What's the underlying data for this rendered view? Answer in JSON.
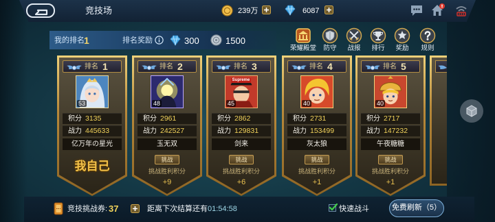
{
  "header": {
    "title": "竞技场",
    "gold": "239万",
    "diamonds": "6087"
  },
  "rank_bar": {
    "my_rank_label": "我的排名",
    "my_rank": "1",
    "reward_label": "排名奖励",
    "reward_diamonds": "300",
    "reward_silver": "1500"
  },
  "menu": [
    {
      "label": "荣耀殿堂",
      "icon": "hall-of-honor-icon"
    },
    {
      "label": "防守",
      "icon": "shield-icon"
    },
    {
      "label": "战报",
      "icon": "crossed-swords-icon"
    },
    {
      "label": "排行",
      "icon": "trophy-icon"
    },
    {
      "label": "奖励",
      "icon": "medal-icon"
    },
    {
      "label": "规则",
      "icon": "question-icon"
    }
  ],
  "labels": {
    "rank": "排名",
    "score": "积分",
    "power": "战力",
    "challenge": "挑战",
    "win_points": "挑战胜利积分"
  },
  "cards": [
    {
      "rank": "1",
      "level": "53",
      "score": "3135",
      "power": "445633",
      "name": "亿万年の星光",
      "self_label": "我自己",
      "is_self": true
    },
    {
      "rank": "2",
      "level": "48",
      "score": "2961",
      "power": "242527",
      "name": "玉无双",
      "win_bonus": "+9"
    },
    {
      "rank": "3",
      "level": "45",
      "score": "2862",
      "power": "129831",
      "name": "剑来",
      "win_bonus": "+6",
      "avatar_text": "Supreme"
    },
    {
      "rank": "4",
      "level": "40",
      "score": "2731",
      "power": "153499",
      "name": "灰太狼",
      "win_bonus": "+1"
    },
    {
      "rank": "5",
      "level": "40",
      "score": "2717",
      "power": "147232",
      "name": "午夜糖糖",
      "win_bonus": "+1"
    }
  ],
  "footer": {
    "ticket_label": "竞技挑战券:",
    "tickets": "37",
    "countdown_label": "距离下次结算还有",
    "countdown": "01:54:58",
    "quick_battle_label": "快速战斗",
    "quick_battle_checked": true,
    "refresh_button": "免费刷新（5）"
  },
  "colors": {
    "gold": "#e0b653",
    "value_yellow": "#f2d35b",
    "self_label": "#f3c24a",
    "accent_blue": "#7fb2dc"
  }
}
